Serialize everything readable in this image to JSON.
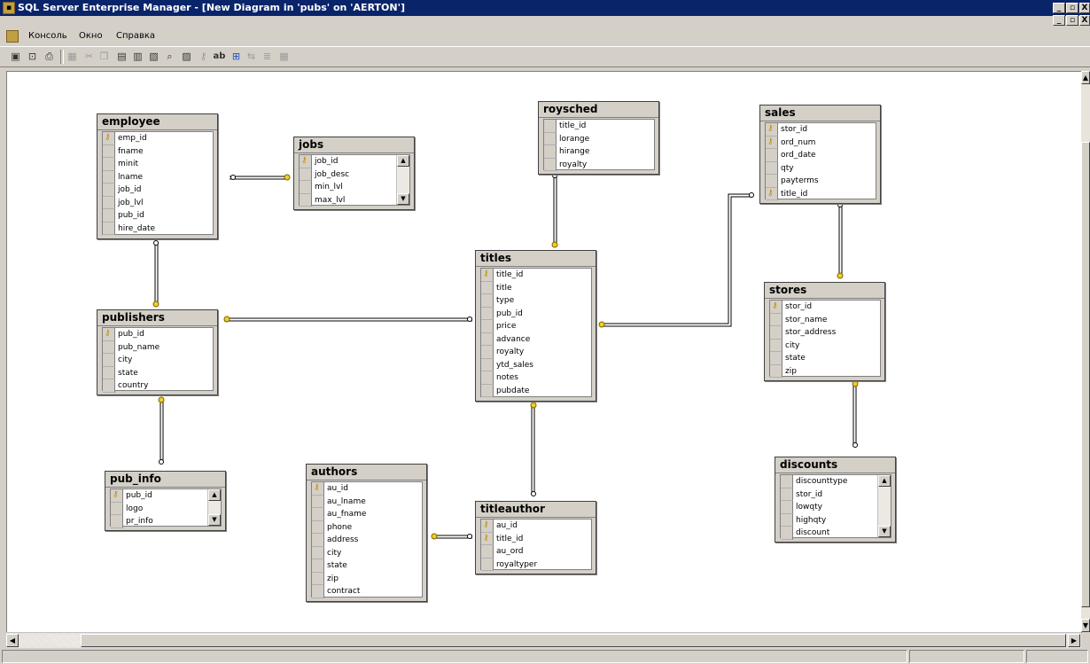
{
  "window": {
    "title": "SQL Server Enterprise Manager - [New Diagram in 'pubs' on 'AERTON']"
  },
  "menu": {
    "items": [
      "Консоль",
      "Окно",
      "Справка"
    ]
  },
  "window_buttons": {
    "min": "_",
    "max": "▫",
    "close": "X"
  },
  "toolbar": {
    "icons": [
      "save-icon",
      "properties-icon",
      "print-icon",
      "new-table-icon",
      "cut-icon",
      "copy-icon",
      "paste-icon",
      "add-table-icon",
      "add-related-icon",
      "zoom-icon",
      "layout-icon",
      "key-icon",
      "text-annotation-icon",
      "arrange-icon",
      "relationship-icon",
      "indexes-icon",
      "grid-icon"
    ]
  },
  "tables": {
    "employee": {
      "name": "employee",
      "columns": [
        "emp_id",
        "fname",
        "minit",
        "lname",
        "job_id",
        "job_lvl",
        "pub_id",
        "hire_date"
      ],
      "keys": [
        "emp_id"
      ]
    },
    "jobs": {
      "name": "jobs",
      "columns": [
        "job_id",
        "job_desc",
        "min_lvl",
        "max_lvl"
      ],
      "keys": [
        "job_id"
      ]
    },
    "roysched": {
      "name": "roysched",
      "columns": [
        "title_id",
        "lorange",
        "hirange",
        "royalty"
      ],
      "keys": []
    },
    "sales": {
      "name": "sales",
      "columns": [
        "stor_id",
        "ord_num",
        "ord_date",
        "qty",
        "payterms",
        "title_id"
      ],
      "keys": [
        "stor_id",
        "ord_num",
        "title_id"
      ]
    },
    "titles": {
      "name": "titles",
      "columns": [
        "title_id",
        "title",
        "type",
        "pub_id",
        "price",
        "advance",
        "royalty",
        "ytd_sales",
        "notes",
        "pubdate"
      ],
      "keys": [
        "title_id"
      ]
    },
    "publishers": {
      "name": "publishers",
      "columns": [
        "pub_id",
        "pub_name",
        "city",
        "state",
        "country"
      ],
      "keys": [
        "pub_id"
      ]
    },
    "stores": {
      "name": "stores",
      "columns": [
        "stor_id",
        "stor_name",
        "stor_address",
        "city",
        "state",
        "zip"
      ],
      "keys": [
        "stor_id"
      ]
    },
    "pub_info": {
      "name": "pub_info",
      "columns": [
        "pub_id",
        "logo",
        "pr_info"
      ],
      "keys": [
        "pub_id"
      ]
    },
    "authors": {
      "name": "authors",
      "columns": [
        "au_id",
        "au_lname",
        "au_fname",
        "phone",
        "address",
        "city",
        "state",
        "zip",
        "contract"
      ],
      "keys": [
        "au_id"
      ]
    },
    "titleauthor": {
      "name": "titleauthor",
      "columns": [
        "au_id",
        "title_id",
        "au_ord",
        "royaltyper"
      ],
      "keys": [
        "au_id",
        "title_id"
      ]
    },
    "discounts": {
      "name": "discounts",
      "columns": [
        "discounttype",
        "stor_id",
        "lowqty",
        "highqty",
        "discount"
      ],
      "keys": []
    }
  },
  "relationships": [
    {
      "from": "jobs",
      "to": "employee"
    },
    {
      "from": "publishers",
      "to": "employee"
    },
    {
      "from": "publishers",
      "to": "pub_info"
    },
    {
      "from": "publishers",
      "to": "titles"
    },
    {
      "from": "titles",
      "to": "roysched"
    },
    {
      "from": "titles",
      "to": "sales"
    },
    {
      "from": "stores",
      "to": "sales"
    },
    {
      "from": "stores",
      "to": "discounts"
    },
    {
      "from": "titles",
      "to": "titleauthor"
    },
    {
      "from": "authors",
      "to": "titleauthor"
    }
  ]
}
